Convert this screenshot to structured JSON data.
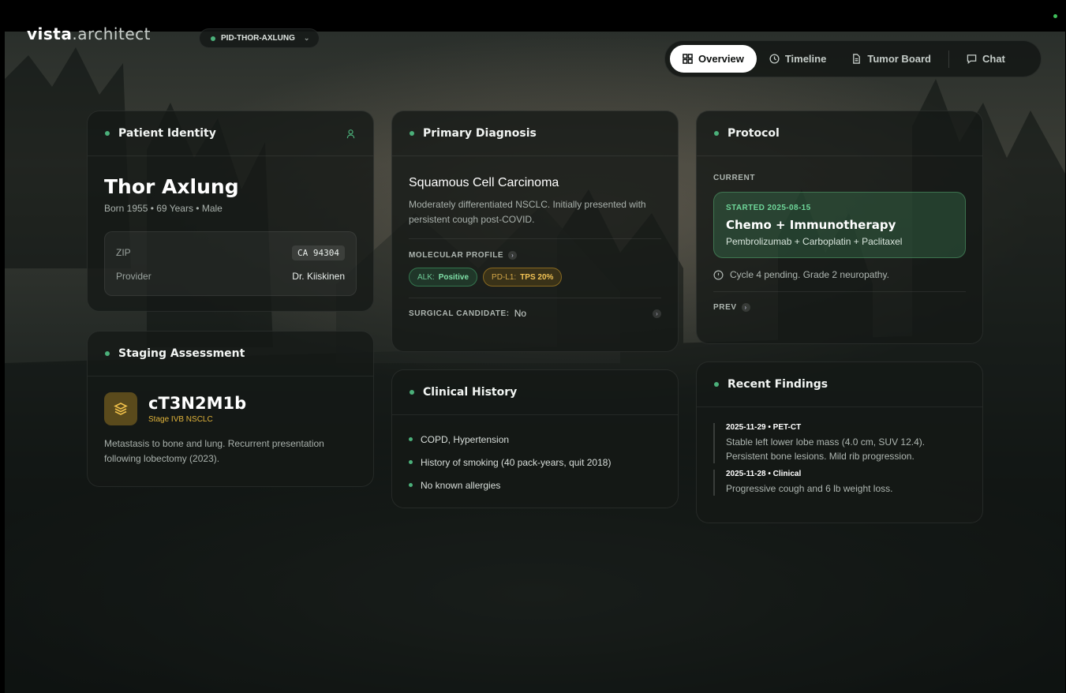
{
  "app": {
    "logo_bold": "vista",
    "logo_rest": ".architect"
  },
  "patient_selector": {
    "id": "PID-THOR-AXLUNG"
  },
  "nav": {
    "tabs": [
      {
        "label": "Overview",
        "icon": "grid-icon",
        "active": true
      },
      {
        "label": "Timeline",
        "icon": "clock-icon",
        "active": false
      },
      {
        "label": "Tumor Board",
        "icon": "document-icon",
        "active": false
      },
      {
        "label": "Chat",
        "icon": "chat-bubble-icon",
        "active": false
      }
    ]
  },
  "identity": {
    "title": "Patient Identity",
    "name": "Thor Axlung",
    "demographics": "Born 1955 • 69 Years • Male",
    "zip_label": "ZIP",
    "zip_value": "CA 94304",
    "provider_label": "Provider",
    "provider_value": "Dr. Kiiskinen"
  },
  "staging": {
    "title": "Staging Assessment",
    "code": "cT3N2M1b",
    "stage": "Stage IVB NSCLC",
    "description": "Metastasis to bone and lung. Recurrent presentation following lobectomy (2023)."
  },
  "diagnosis": {
    "title": "Primary Diagnosis",
    "name": "Squamous Cell Carcinoma",
    "description": "Moderately differentiated NSCLC. Initially presented with persistent cough post-COVID.",
    "molecular_label": "MOLECULAR PROFILE",
    "chips": [
      {
        "key": "ALK:",
        "value": "Positive",
        "tone": "green"
      },
      {
        "key": "PD-L1:",
        "value": "TPS 20%",
        "tone": "amber"
      }
    ],
    "surgical_label": "SURGICAL CANDIDATE:",
    "surgical_value": "No"
  },
  "history": {
    "title": "Clinical History",
    "items": [
      "COPD, Hypertension",
      "History of smoking (40 pack-years, quit 2018)",
      "No known allergies"
    ]
  },
  "protocol": {
    "title": "Protocol",
    "current_label": "CURRENT",
    "started": "STARTED 2025-08-15",
    "regimen": "Chemo + Immunotherapy",
    "drugs": "Pembrolizumab + Carboplatin + Paclitaxel",
    "note": "Cycle 4 pending. Grade 2 neuropathy.",
    "prev_label": "PREV"
  },
  "findings": {
    "title": "Recent Findings",
    "items": [
      {
        "header": "2025-11-29 • PET-CT",
        "text": "Stable left lower lobe mass (4.0 cm, SUV 12.4). Persistent bone lesions. Mild rib progression."
      },
      {
        "header": "2025-11-28 • Clinical",
        "text": "Progressive cough and 6 lb weight loss."
      }
    ]
  },
  "colors": {
    "accent_green": "#4bb07a",
    "amber": "#e0b33a",
    "background": "#1a1e1c"
  }
}
